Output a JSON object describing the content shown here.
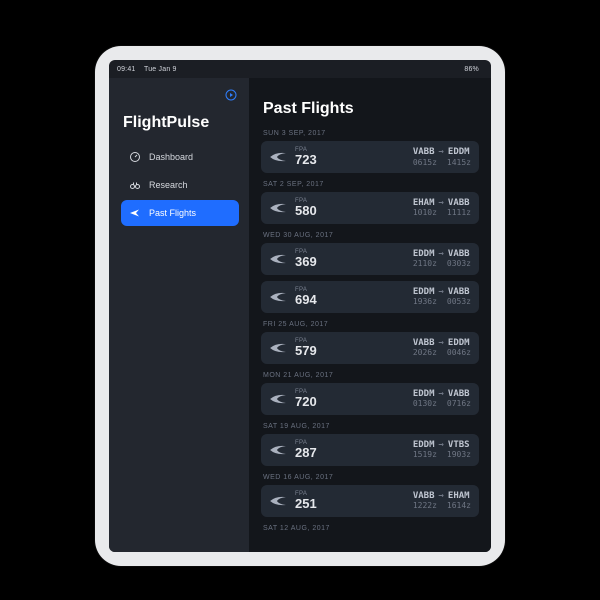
{
  "status_bar": {
    "time": "09:41",
    "date": "Tue Jan 9",
    "battery_pct": "86%"
  },
  "brand": "FlightPulse",
  "sidebar": {
    "items": [
      {
        "label": "Dashboard",
        "active": false
      },
      {
        "label": "Research",
        "active": false
      },
      {
        "label": "Past Flights",
        "active": true
      }
    ]
  },
  "page": {
    "title": "Past Flights"
  },
  "groups": [
    {
      "label": "SUN 3 SEP, 2017",
      "flights": [
        {
          "fpa": "FPA",
          "num": "723",
          "from": "VABB",
          "to": "EDDM",
          "dep": "0615z",
          "arr": "1415z"
        }
      ]
    },
    {
      "label": "SAT 2 SEP, 2017",
      "flights": [
        {
          "fpa": "FPA",
          "num": "580",
          "from": "EHAM",
          "to": "VABB",
          "dep": "1010z",
          "arr": "1111z"
        }
      ]
    },
    {
      "label": "WED 30 AUG, 2017",
      "flights": [
        {
          "fpa": "FPA",
          "num": "369",
          "from": "EDDM",
          "to": "VABB",
          "dep": "2110z",
          "arr": "0303z"
        },
        {
          "fpa": "FPA",
          "num": "694",
          "from": "EDDM",
          "to": "VABB",
          "dep": "1936z",
          "arr": "0053z"
        }
      ]
    },
    {
      "label": "FRI 25 AUG, 2017",
      "flights": [
        {
          "fpa": "FPA",
          "num": "579",
          "from": "VABB",
          "to": "EDDM",
          "dep": "2026z",
          "arr": "0046z"
        }
      ]
    },
    {
      "label": "MON 21 AUG, 2017",
      "flights": [
        {
          "fpa": "FPA",
          "num": "720",
          "from": "EDDM",
          "to": "VABB",
          "dep": "0130z",
          "arr": "0716z"
        }
      ]
    },
    {
      "label": "SAT 19 AUG, 2017",
      "flights": [
        {
          "fpa": "FPA",
          "num": "287",
          "from": "EDDM",
          "to": "VTBS",
          "dep": "1519z",
          "arr": "1903z"
        }
      ]
    },
    {
      "label": "WED 16 AUG, 2017",
      "flights": [
        {
          "fpa": "FPA",
          "num": "251",
          "from": "VABB",
          "to": "EHAM",
          "dep": "1222z",
          "arr": "1614z"
        }
      ]
    },
    {
      "label": "SAT 12 AUG, 2017",
      "flights": []
    }
  ]
}
